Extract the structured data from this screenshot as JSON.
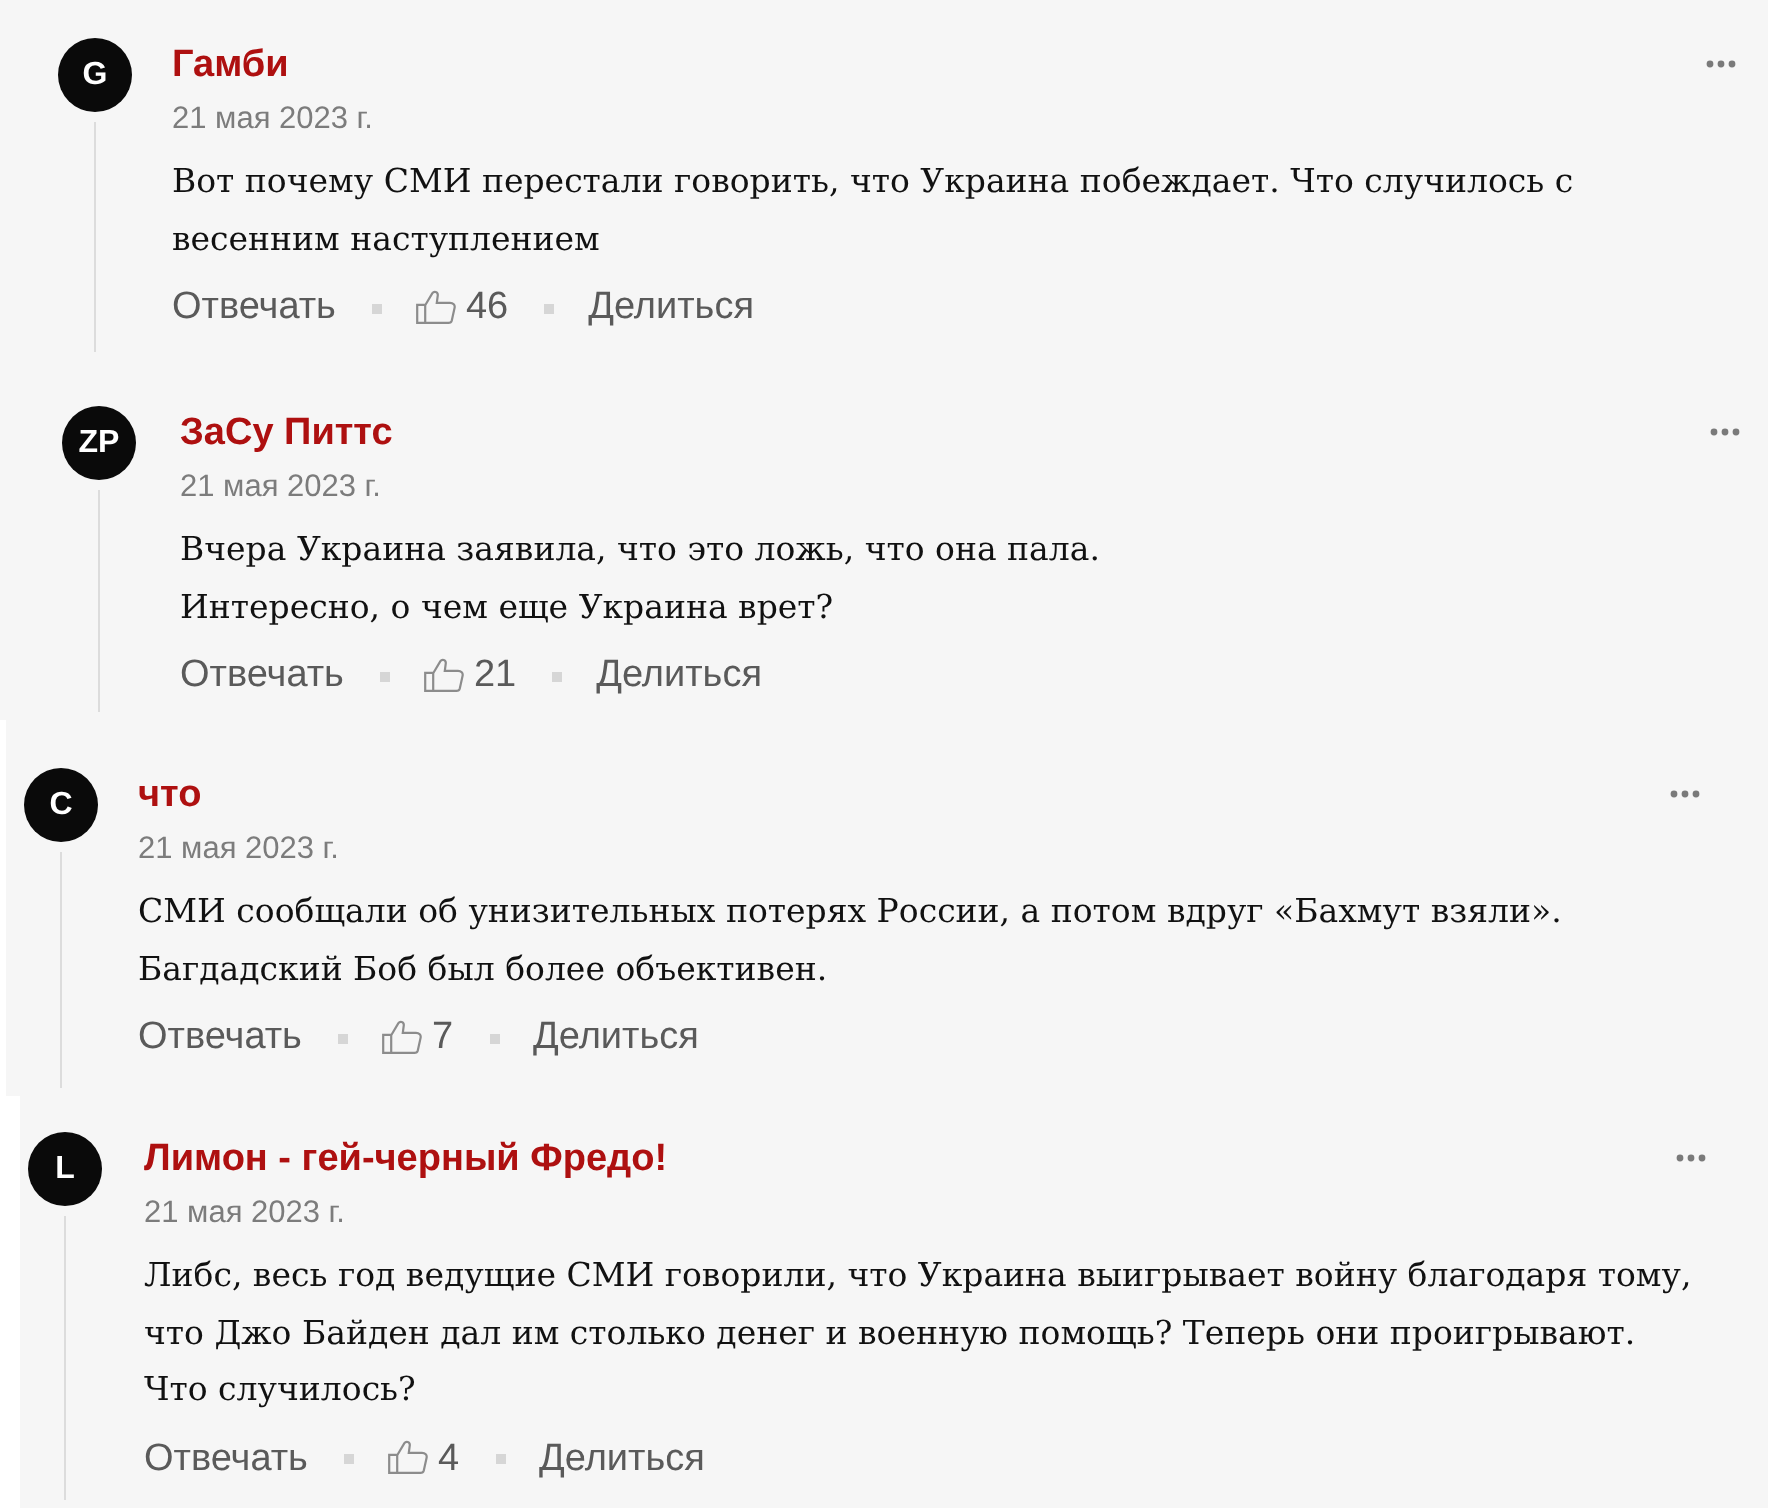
{
  "comments": [
    {
      "avatar": "G",
      "author": "Гамби",
      "date": "21 мая 2023 г.",
      "text": "Вот почему СМИ перестали говорить, что Украина побеждает. Что случилось с\nвесенним наступлением",
      "reply": "Отвечать",
      "likes": "46",
      "share": "Делиться"
    },
    {
      "avatar": "ZP",
      "author": "ЗаСу Питтс",
      "date": "21 мая 2023 г.",
      "text": "Вчера Украина заявила, что это ложь, что она пала.\nИнтересно, о чем еще Украина врет?",
      "reply": "Отвечать",
      "likes": "21",
      "share": "Делиться"
    },
    {
      "avatar": "C",
      "author": "что",
      "date": "21 мая 2023 г.",
      "text": "СМИ сообщали об унизительных потерях России, а потом вдруг «Бахмут взяли».\nБагдадский Боб был более объективен.",
      "reply": "Отвечать",
      "likes": "7",
      "share": "Делиться"
    },
    {
      "avatar": "L",
      "author": "Лимон - гей-черный Фредо!",
      "date": "21 мая 2023 г.",
      "text": "Либс, весь год ведущие СМИ говорили, что Украина выигрывает войну благодаря тому,\nчто Джо Байден дал им столько денег и военную помощь? Теперь они проигрывают.\nЧто случилось?",
      "reply": "Отвечать",
      "likes": "4",
      "share": "Делиться"
    }
  ]
}
